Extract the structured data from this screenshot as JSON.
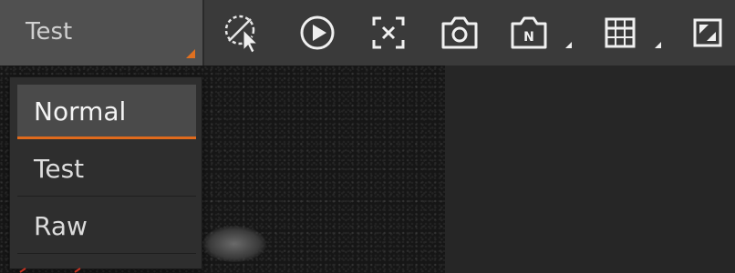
{
  "mode_select": {
    "label": "Test"
  },
  "dropdown": {
    "items": [
      {
        "label": "Normal",
        "selected": true
      },
      {
        "label": "Test",
        "selected": false
      },
      {
        "label": "Raw",
        "selected": false
      }
    ],
    "accent_color": "#e06a1c"
  },
  "toolbar": {
    "icons": [
      "select-off-icon",
      "play-icon",
      "fit-screen-icon",
      "camera-icon",
      "camera-n-icon",
      "grid-icon",
      "fullscreen-icon"
    ]
  }
}
